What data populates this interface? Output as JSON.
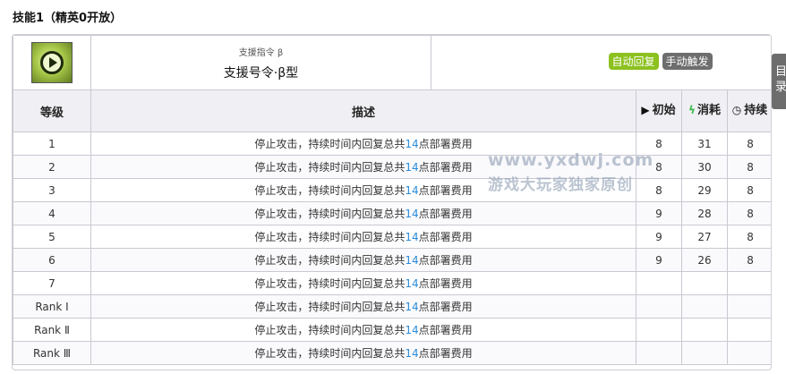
{
  "section_title": "技能1（精英0开放）",
  "skill": {
    "icon": "play-circle-icon",
    "name_alt": "支援指令 β",
    "name": "支援号令·β型",
    "tags": [
      "自动回复",
      "手动触发"
    ]
  },
  "columns": {
    "level": "等级",
    "desc": "描述",
    "initial": "初始",
    "cost": "消耗",
    "duration": "持续"
  },
  "rows": [
    {
      "level": "1",
      "desc_before": "停止攻击，持续时间内回复总共",
      "desc_num": "14",
      "desc_after": "点部署费用",
      "initial": "8",
      "cost": "31",
      "duration": "8"
    },
    {
      "level": "2",
      "desc_before": "停止攻击，持续时间内回复总共",
      "desc_num": "14",
      "desc_after": "点部署费用",
      "initial": "8",
      "cost": "30",
      "duration": "8"
    },
    {
      "level": "3",
      "desc_before": "停止攻击，持续时间内回复总共",
      "desc_num": "14",
      "desc_after": "点部署费用",
      "initial": "8",
      "cost": "29",
      "duration": "8"
    },
    {
      "level": "4",
      "desc_before": "停止攻击，持续时间内回复总共",
      "desc_num": "14",
      "desc_after": "点部署费用",
      "initial": "9",
      "cost": "28",
      "duration": "8"
    },
    {
      "level": "5",
      "desc_before": "停止攻击，持续时间内回复总共",
      "desc_num": "14",
      "desc_after": "点部署费用",
      "initial": "9",
      "cost": "27",
      "duration": "8"
    },
    {
      "level": "6",
      "desc_before": "停止攻击，持续时间内回复总共",
      "desc_num": "14",
      "desc_after": "点部署费用",
      "initial": "9",
      "cost": "26",
      "duration": "8"
    },
    {
      "level": "7",
      "desc_before": "停止攻击，持续时间内回复总共",
      "desc_num": "14",
      "desc_after": "点部署费用",
      "initial": "",
      "cost": "",
      "duration": ""
    },
    {
      "level": "Rank Ⅰ",
      "desc_before": "停止攻击，持续时间内回复总共",
      "desc_num": "14",
      "desc_after": "点部署费用",
      "initial": "",
      "cost": "",
      "duration": ""
    },
    {
      "level": "Rank Ⅱ",
      "desc_before": "停止攻击，持续时间内回复总共",
      "desc_num": "14",
      "desc_after": "点部署费用",
      "initial": "",
      "cost": "",
      "duration": ""
    },
    {
      "level": "Rank Ⅲ",
      "desc_before": "停止攻击，持续时间内回复总共",
      "desc_num": "14",
      "desc_after": "点部署费用",
      "initial": "",
      "cost": "",
      "duration": ""
    }
  ],
  "side_tab": "目录",
  "watermark": {
    "url": "www.yxdwj.com",
    "text": "游戏大玩家独家原创"
  },
  "colors": {
    "tag_auto": "#8cc11f",
    "tag_manual": "#6e6e6e",
    "highlight_number": "#2a8bd9",
    "cost_icon": "#38b84a"
  }
}
